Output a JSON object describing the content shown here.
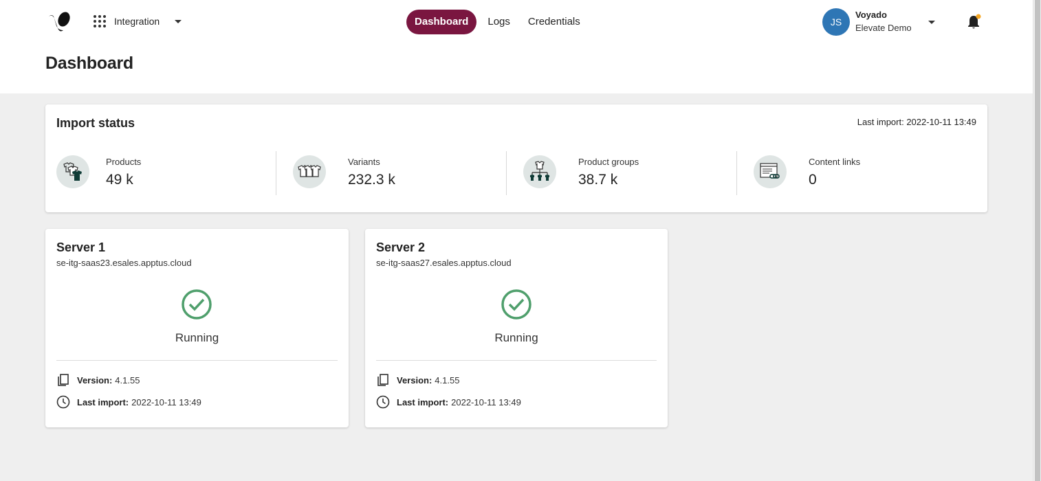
{
  "header": {
    "app_name": "Integration",
    "nav": [
      {
        "label": "Dashboard",
        "active": true
      },
      {
        "label": "Logs",
        "active": false
      },
      {
        "label": "Credentials",
        "active": false
      }
    ],
    "user": {
      "initials": "JS",
      "org": "Voyado",
      "account": "Elevate Demo"
    },
    "accent_color": "#7a1640",
    "notification_dot_color": "#f5a623"
  },
  "page_title": "Dashboard",
  "import_status": {
    "title": "Import status",
    "last_import": "Last import: 2022-10-11 13:49",
    "stats": [
      {
        "label": "Products",
        "value": "49 k",
        "icon": "products-icon"
      },
      {
        "label": "Variants",
        "value": "232.3 k",
        "icon": "variants-icon"
      },
      {
        "label": "Product groups",
        "value": "38.7 k",
        "icon": "product-groups-icon"
      },
      {
        "label": "Content links",
        "value": "0",
        "icon": "content-links-icon"
      }
    ]
  },
  "servers": [
    {
      "name": "Server 1",
      "host": "se-itg-saas23.esales.apptus.cloud",
      "status": "Running",
      "version_label": "Version:",
      "version": "4.1.55",
      "last_import_label": "Last import:",
      "last_import": "2022-10-11 13:49"
    },
    {
      "name": "Server 2",
      "host": "se-itg-saas27.esales.apptus.cloud",
      "status": "Running",
      "version_label": "Version:",
      "version": "4.1.55",
      "last_import_label": "Last import:",
      "last_import": "2022-10-11 13:49"
    }
  ],
  "status_color": "#4f9f6c"
}
